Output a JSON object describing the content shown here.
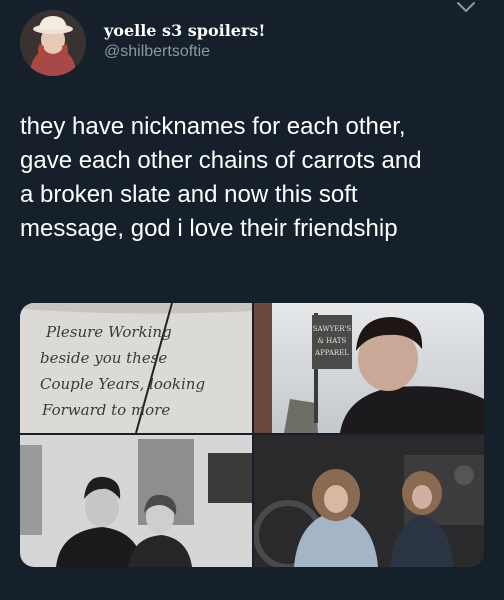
{
  "tweet": {
    "display_name": "yoelle s3 spoilers!",
    "handle": "@shilbertsoftie",
    "text_lines": [
      "they have nicknames for each other,",
      "gave each other chains of carrots and",
      "a broken slate and now this soft",
      "message, god i love their friendship"
    ]
  },
  "photos": {
    "note_lines": [
      "Plesure Working",
      "beside you these",
      "Couple Years, looking",
      "Forward to more"
    ],
    "sign_lines": [
      "SAWYER'S",
      "& HATS",
      "APPAREL"
    ]
  },
  "colors": {
    "background": "#15202b",
    "text_primary": "#ffffff",
    "text_secondary": "#8899a6"
  },
  "icons": {
    "more": "chevron-down-icon"
  }
}
